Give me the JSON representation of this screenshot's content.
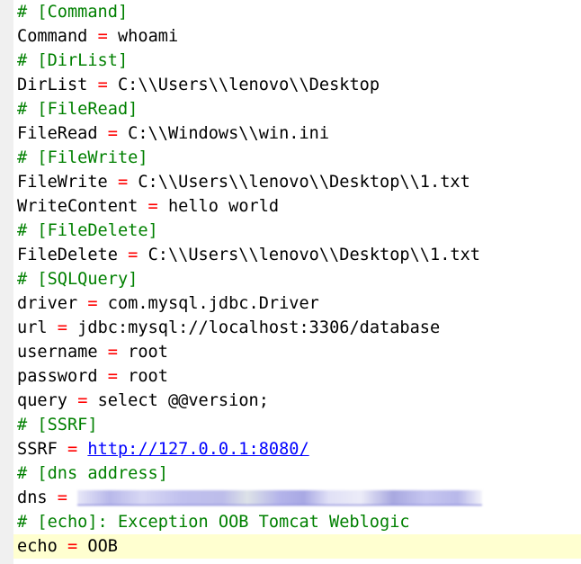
{
  "lines": [
    {
      "type": "comment",
      "text": "# [Command]"
    },
    {
      "type": "kv",
      "key": "Command",
      "op": "=",
      "value": "whoami"
    },
    {
      "type": "comment",
      "text": "# [DirList]"
    },
    {
      "type": "kv",
      "key": "DirList",
      "op": "=",
      "value": "C:\\\\Users\\\\lenovo\\\\Desktop"
    },
    {
      "type": "comment",
      "text": "# [FileRead]"
    },
    {
      "type": "kv",
      "key": "FileRead",
      "op": "=",
      "value": "C:\\\\Windows\\\\win.ini"
    },
    {
      "type": "comment",
      "text": "# [FileWrite]"
    },
    {
      "type": "kv",
      "key": "FileWrite",
      "op": "=",
      "value": "C:\\\\Users\\\\lenovo\\\\Desktop\\\\1.txt"
    },
    {
      "type": "kv",
      "key": "WriteContent",
      "op": "=",
      "value": "hello world"
    },
    {
      "type": "comment",
      "text": "# [FileDelete]"
    },
    {
      "type": "kv",
      "key": "FileDelete",
      "op": "=",
      "value": "C:\\\\Users\\\\lenovo\\\\Desktop\\\\1.txt"
    },
    {
      "type": "comment",
      "text": "# [SQLQuery]"
    },
    {
      "type": "kv",
      "key": "driver",
      "op": "=",
      "value": "com.mysql.jdbc.Driver"
    },
    {
      "type": "kv",
      "key": "url",
      "op": "=",
      "value": "jdbc:mysql://localhost:3306/database"
    },
    {
      "type": "kv",
      "key": "username",
      "op": "=",
      "value": "root"
    },
    {
      "type": "kv",
      "key": "password",
      "op": "=",
      "value": "root"
    },
    {
      "type": "kv",
      "key": "query",
      "op": "=",
      "value": "select @@version;"
    },
    {
      "type": "comment",
      "text": "# [SSRF]"
    },
    {
      "type": "link",
      "key": "SSRF",
      "op": "=",
      "value": "http://127.0.0.1:8080/"
    },
    {
      "type": "comment",
      "text": "# [dns address]"
    },
    {
      "type": "redacted",
      "key": "dns",
      "op": "="
    },
    {
      "type": "comment",
      "text": "# [echo]: Exception OOB Tomcat Weblogic"
    },
    {
      "type": "kv",
      "key": "echo",
      "op": "=",
      "value": "OOB",
      "current": true
    }
  ],
  "colors": {
    "comment": "#008000",
    "operator": "#ff0000",
    "link": "#0000ff",
    "current_line": "#ffffd0",
    "gutter": "#f0f0f0"
  }
}
